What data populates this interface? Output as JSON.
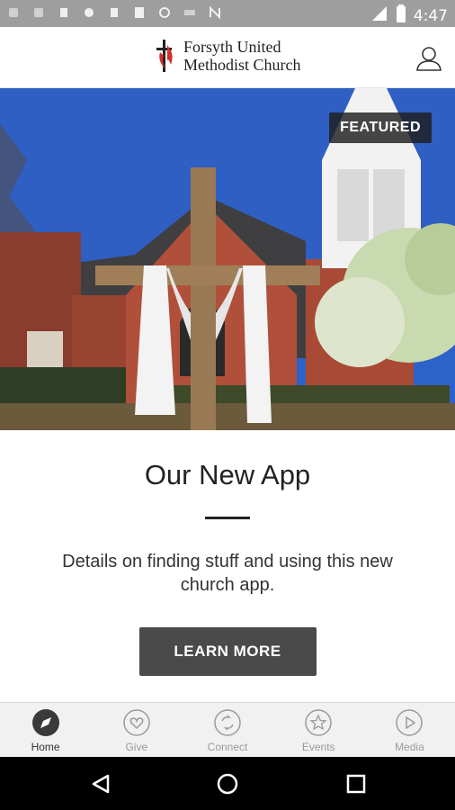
{
  "status_bar": {
    "time": "4:47",
    "icons": [
      "notification-icons",
      "wifi-icon",
      "cell-signal-icon",
      "battery-icon"
    ]
  },
  "header": {
    "logo_line1": "Forsyth United",
    "logo_line2": "Methodist Church",
    "profile_icon": "user-icon"
  },
  "hero": {
    "badge": "FEATURED",
    "image": "church-cross-photo"
  },
  "content": {
    "title": "Our New App",
    "description": "Details on finding stuff and using this new church app.",
    "button_label": "LEARN MORE"
  },
  "bottom_nav": {
    "items": [
      {
        "label": "Home",
        "icon": "compass-icon",
        "active": true
      },
      {
        "label": "Give",
        "icon": "heart-icon",
        "active": false
      },
      {
        "label": "Connect",
        "icon": "connect-icon",
        "active": false
      },
      {
        "label": "Events",
        "icon": "star-icon",
        "active": false
      },
      {
        "label": "Media",
        "icon": "play-icon",
        "active": false
      }
    ]
  },
  "colors": {
    "status_bar": "#9e9e9e",
    "button": "#4a4a4a",
    "logo_red": "#d0312d"
  }
}
